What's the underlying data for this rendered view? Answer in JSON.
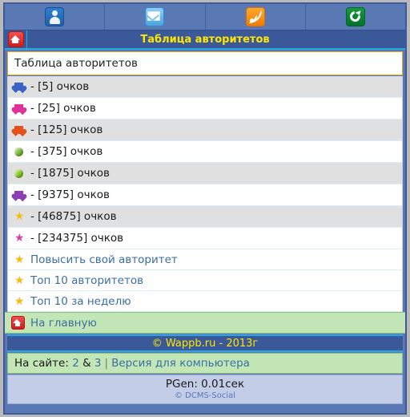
{
  "topnav": [
    {
      "icon": "user-icon",
      "label": "Профиль"
    },
    {
      "icon": "mail-icon",
      "label": "Почта"
    },
    {
      "icon": "rss-icon",
      "label": "RSS"
    },
    {
      "icon": "refresh-icon",
      "label": "Обновить"
    }
  ],
  "titlebar": {
    "home_icon": "home-icon",
    "title": "Таблица авторитетов"
  },
  "headbox": {
    "text": "Таблица авторитетов"
  },
  "rows": [
    {
      "icon": "heart-icon",
      "color": "#3a63c8",
      "text": "- [5] очков",
      "points": 5
    },
    {
      "icon": "heart-icon",
      "color": "#e0319b",
      "text": "- [25] очков",
      "points": 25
    },
    {
      "icon": "heart-icon",
      "color": "#e8501b",
      "text": "- [125] очков",
      "points": 125
    },
    {
      "icon": "sphere-icon",
      "color": "#7fbf3f",
      "text": "- [375] очков",
      "points": 375
    },
    {
      "icon": "sphere-icon",
      "color": "#8ccc2a",
      "text": "- [1875] очков",
      "points": 1875
    },
    {
      "icon": "shield-icon",
      "color": "#8b3fb5",
      "text": "- [9375] очков",
      "points": 9375
    },
    {
      "icon": "star-icon",
      "color": "#f5bc14",
      "text": "- [46875] очков",
      "points": 46875
    },
    {
      "icon": "star-icon",
      "color": "#d83fae",
      "text": "- [234375] очков",
      "points": 234375
    }
  ],
  "links": [
    {
      "icon": "star-icon",
      "color": "#f5bc14",
      "label": "Повысить свой авторитет"
    },
    {
      "icon": "star-icon",
      "color": "#f5bc14",
      "label": "Топ 10 авторитетов"
    },
    {
      "icon": "star-icon",
      "color": "#f5bc14",
      "label": "Топ 10 за неделю"
    }
  ],
  "home_link": {
    "icon": "home-icon",
    "label": "На главную"
  },
  "copyright": {
    "text": "© Wappb.ru - 2013г"
  },
  "online": {
    "label": "На сайте:",
    "users": "2",
    "amp": "&",
    "guests": "3",
    "divider": "|",
    "desktop_link": "Версия для компьютера"
  },
  "pgen": {
    "time": "PGen: 0.01сек",
    "engine": "© DCMS-Social"
  },
  "colors": {
    "frame_blue": "#3b5998",
    "nav_blue": "#5a78b4",
    "accent_cyan": "#27a8e0",
    "title_yellow": "#ffe600",
    "link_blue": "#3b6ea5",
    "green_bar": "#c3e6b6",
    "row_alt": "#e0e0e0",
    "head_border": "#e8a317"
  }
}
